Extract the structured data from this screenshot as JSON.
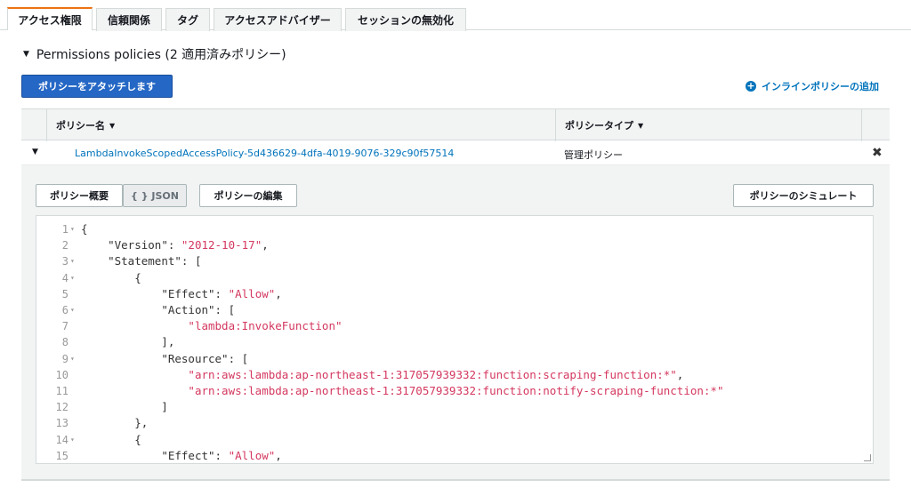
{
  "tabs": [
    {
      "label": "アクセス権限",
      "active": true
    },
    {
      "label": "信頼関係",
      "active": false
    },
    {
      "label": "タグ",
      "active": false
    },
    {
      "label": "アクセスアドバイザー",
      "active": false
    },
    {
      "label": "セッションの無効化",
      "active": false
    }
  ],
  "section": {
    "title": "Permissions policies (2 適用済みポリシー)",
    "attach_button": "ポリシーをアタッチします",
    "inline_add": "インラインポリシーの追加"
  },
  "table": {
    "headers": [
      "ポリシー名",
      "ポリシータイプ"
    ],
    "rows": [
      {
        "name": "LambdaInvokeScopedAccessPolicy-5d436629-4dfa-4019-9076-329c90f57514",
        "type": "管理ポリシー"
      }
    ]
  },
  "detail": {
    "summary_button": "ポリシー概要",
    "json_button": "{ } JSON",
    "edit_button": "ポリシーの編集",
    "simulate_button": "ポリシーのシミュレート"
  },
  "code_lines": [
    {
      "n": "1",
      "fold": true,
      "text": "{"
    },
    {
      "n": "2",
      "fold": false,
      "text": "    \"Version\": \"2012-10-17\","
    },
    {
      "n": "3",
      "fold": true,
      "text": "    \"Statement\": ["
    },
    {
      "n": "4",
      "fold": true,
      "text": "        {"
    },
    {
      "n": "5",
      "fold": false,
      "text": "            \"Effect\": \"Allow\","
    },
    {
      "n": "6",
      "fold": true,
      "text": "            \"Action\": ["
    },
    {
      "n": "7",
      "fold": false,
      "text": "                \"lambda:InvokeFunction\""
    },
    {
      "n": "8",
      "fold": false,
      "text": "            ],"
    },
    {
      "n": "9",
      "fold": true,
      "text": "            \"Resource\": ["
    },
    {
      "n": "10",
      "fold": false,
      "text": "                \"arn:aws:lambda:ap-northeast-1:317057939332:function:scraping-function:*\","
    },
    {
      "n": "11",
      "fold": false,
      "text": "                \"arn:aws:lambda:ap-northeast-1:317057939332:function:notify-scraping-function:*\""
    },
    {
      "n": "12",
      "fold": false,
      "text": "            ]"
    },
    {
      "n": "13",
      "fold": false,
      "text": "        },"
    },
    {
      "n": "14",
      "fold": true,
      "text": "        {"
    },
    {
      "n": "15",
      "fold": false,
      "text": "            \"Effect\": \"Allow\","
    }
  ],
  "colors": {
    "accent": "#ec7211",
    "link": "#0073bb",
    "primary_button": "#2467c5",
    "json_string": "#d4385f"
  }
}
